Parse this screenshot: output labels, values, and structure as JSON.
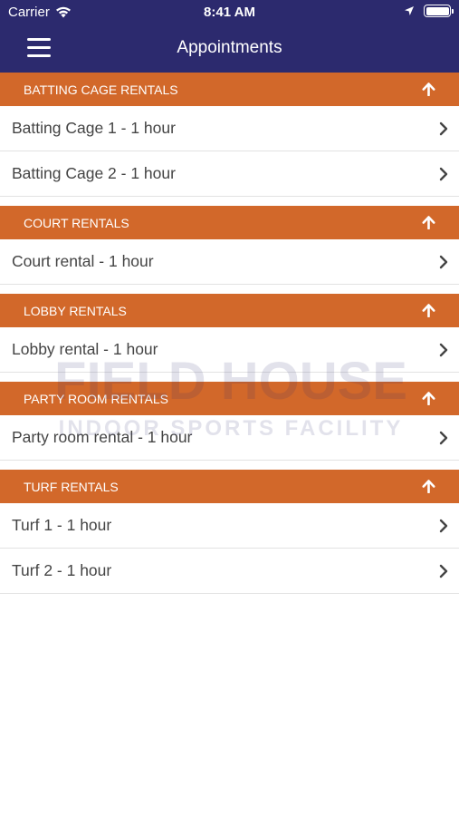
{
  "status_bar": {
    "carrier": "Carrier",
    "time": "8:41 AM"
  },
  "navbar": {
    "title": "Appointments"
  },
  "colors": {
    "nav_bg": "#2c2a6e",
    "section_bg": "#d2682a",
    "row_text": "#444444"
  },
  "watermark": {
    "line1": "FIELD HOUSE",
    "line2": "INDOOR SPORTS FACILITY"
  },
  "sections": [
    {
      "title": "BATTING CAGE RENTALS",
      "items": [
        "Batting Cage 1 - 1 hour",
        "Batting Cage 2 - 1 hour"
      ]
    },
    {
      "title": "COURT RENTALS",
      "items": [
        "Court rental - 1 hour"
      ]
    },
    {
      "title": "LOBBY RENTALS",
      "items": [
        "Lobby rental - 1 hour"
      ]
    },
    {
      "title": "PARTY ROOM RENTALS",
      "items": [
        "Party room rental - 1 hour"
      ]
    },
    {
      "title": "TURF RENTALS",
      "items": [
        "Turf 1 - 1 hour",
        "Turf 2 - 1 hour"
      ]
    }
  ]
}
